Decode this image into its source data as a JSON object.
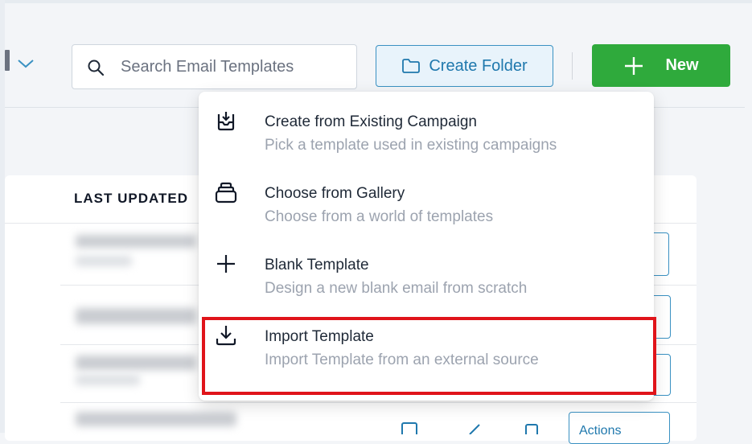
{
  "toolbar": {
    "search_placeholder": "Search Email Templates",
    "create_folder_label": "Create Folder",
    "new_label": "New"
  },
  "table": {
    "column_last_updated": "LAST UPDATED",
    "actions_label": "Actions"
  },
  "menu": {
    "items": [
      {
        "icon": "inbox-download-icon",
        "title": "Create from Existing Campaign",
        "description": "Pick a template used in existing campaigns"
      },
      {
        "icon": "gallery-stack-icon",
        "title": "Choose from Gallery",
        "description": "Choose from a world of templates"
      },
      {
        "icon": "plus-icon",
        "title": "Blank Template",
        "description": "Design a new blank email from scratch"
      },
      {
        "icon": "download-icon",
        "title": "Import Template",
        "description": "Import Template from an external source"
      }
    ]
  },
  "colors": {
    "accent_blue": "#1f78ad",
    "new_green": "#2faa3c",
    "highlight_red": "#e0141a"
  }
}
